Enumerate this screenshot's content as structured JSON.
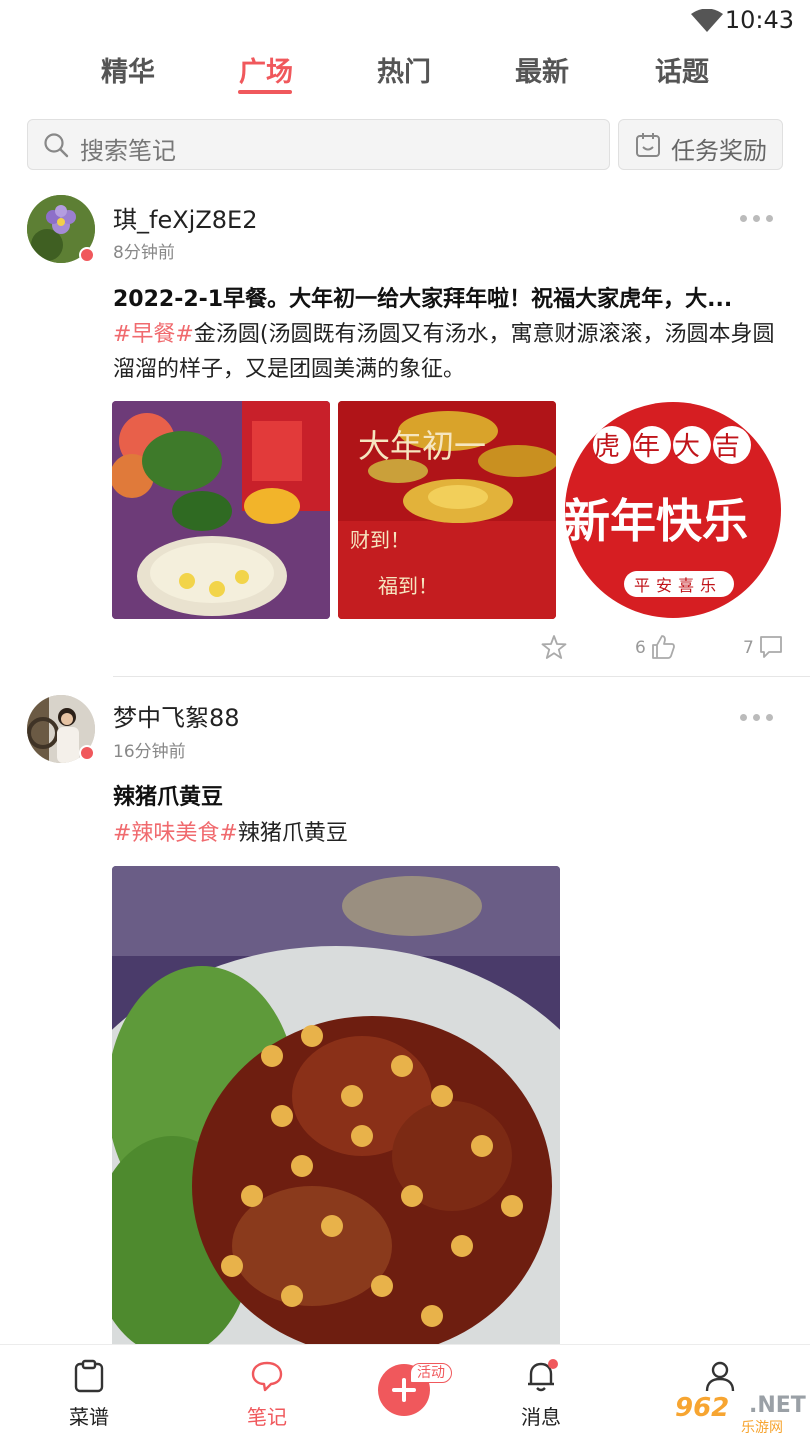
{
  "status_bar": {
    "time": "10:43",
    "wifi_icon": "wifi-icon"
  },
  "tabs": [
    {
      "label": "精华",
      "active": false
    },
    {
      "label": "广场",
      "active": true
    },
    {
      "label": "热门",
      "active": false
    },
    {
      "label": "最新",
      "active": false
    },
    {
      "label": "话题",
      "active": false
    }
  ],
  "search": {
    "placeholder": "搜索笔记",
    "icon": "search-icon"
  },
  "task_button": {
    "label": "任务奖励",
    "icon": "calendar-icon"
  },
  "posts": [
    {
      "username": "琪_feXjZ8E2",
      "time_ago": "8分钟前",
      "title": "2022-2-1早餐。大年初一给大家拜年啦！祝福大家虎年，大...",
      "tag": "#早餐#",
      "text": "金汤圆(汤圆既有汤圆又有汤水，寓意财源滚滚，汤圆本身圆溜溜的样子，又是团圆美满的象征。",
      "images": [
        {
          "caption": ""
        },
        {
          "caption": "大年初一",
          "line1": "财到！",
          "line2": "福到！"
        },
        {
          "caption": "虎年大吉",
          "line1": "新年快乐",
          "line2": "平安喜乐"
        }
      ],
      "like_count": "6",
      "comment_count": "7"
    },
    {
      "username": "梦中飞絮88",
      "time_ago": "16分钟前",
      "title": "辣猪爪黄豆",
      "tag": "#辣味美食#",
      "text": "辣猪爪黄豆"
    }
  ],
  "bottom_nav": {
    "recipes": "菜谱",
    "notes": "笔记",
    "add_badge": "活动",
    "messages": "消息",
    "profile": ""
  },
  "watermark": {
    "num": "962",
    "net": ".NET",
    "sub": "乐游网"
  },
  "colors": {
    "accent": "#f0585c",
    "tag": "#f06a6e"
  }
}
